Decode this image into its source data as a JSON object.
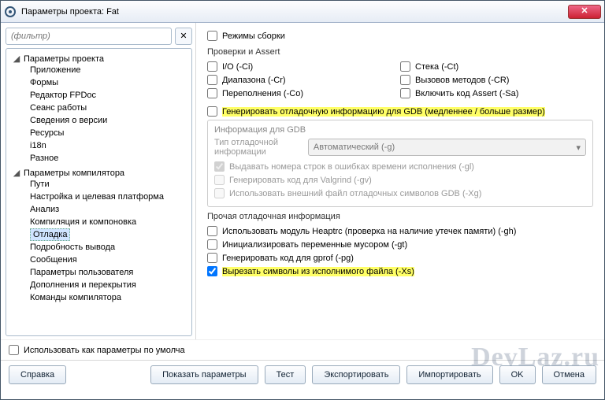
{
  "window": {
    "title": "Параметры проекта: Fat"
  },
  "filter": {
    "placeholder": "(фильтр)"
  },
  "tree": {
    "groups": [
      {
        "label": "Параметры проекта",
        "items": [
          "Приложение",
          "Формы",
          "Редактор FPDoc",
          "Сеанс работы",
          "Сведения о версии",
          "Ресурсы",
          "i18n",
          "Разное"
        ]
      },
      {
        "label": "Параметры компилятора",
        "items": [
          "Пути",
          "Настройка и целевая платформа",
          "Анализ",
          "Компиляция и компоновка",
          "Отладка",
          "Подробность вывода",
          "Сообщения",
          "Параметры пользователя",
          "Дополнения и перекрытия",
          "Команды компилятора"
        ],
        "selected": "Отладка"
      }
    ]
  },
  "right": {
    "build_modes": "Режимы сборки",
    "checks_title": "Проверки и Assert",
    "checks": {
      "io": "I/O (-Ci)",
      "stack": "Стека (-Ct)",
      "range": "Диапазона (-Cr)",
      "methods": "Вызовов методов (-CR)",
      "overflow": "Переполнения (-Co)",
      "assert": "Включить код Assert (-Sa)"
    },
    "gen_debug": "Генерировать отладочную информацию для GDB (медленнее / больше размер)",
    "gdb_title": "Информация для GDB",
    "gdb_type_label": "Тип отладочной информации",
    "gdb_type_value": "Автоматический (-g)",
    "gdb_lines": "Выдавать номера строк в ошибках времени исполнения (-gl)",
    "gdb_valgrind": "Генерировать код для Valgrind (-gv)",
    "gdb_extern": "Использовать внешний файл отладочных символов GDB (-Xg)",
    "other_title": "Прочая отладочная информация",
    "o_heaptrc": "Использовать модуль Heaptrc (проверка на наличие утечек памяти) (-gh)",
    "o_trash": "Инициализировать переменные мусором (-gt)",
    "o_gprof": "Генерировать код для gprof (-pg)",
    "o_strip": "Вырезать символы из исполнимого файла (-Xs)"
  },
  "bottom": {
    "default": "Использовать как параметры по умолча",
    "help": "Справка",
    "show": "Показать параметры",
    "test": "Тест",
    "export": "Экспортировать",
    "import": "Импортировать",
    "ok": "OK",
    "cancel": "Отмена"
  },
  "watermark": "DevLaz.ru"
}
